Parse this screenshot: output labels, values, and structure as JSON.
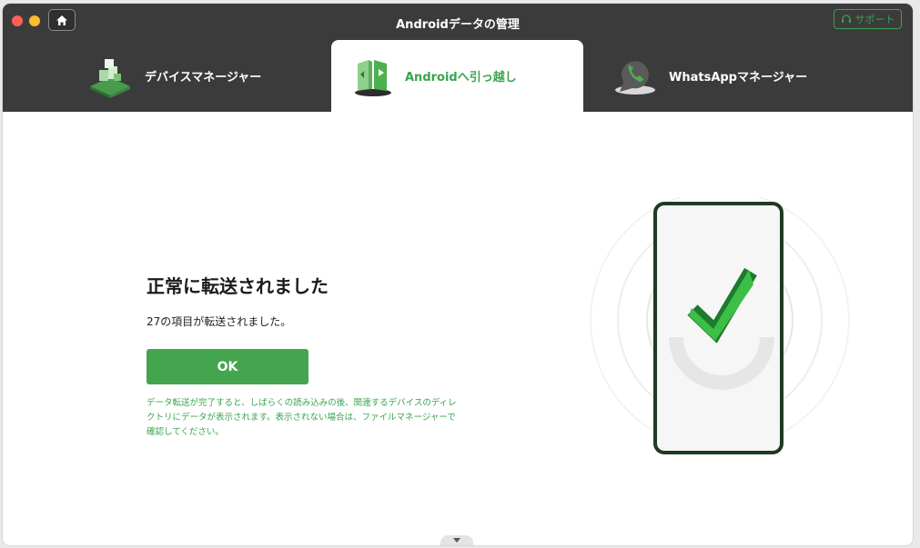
{
  "window": {
    "title": "Androidデータの管理",
    "support_label": "サポート"
  },
  "tabs": [
    {
      "label": "デバイスマネージャー",
      "icon": "device-manager-icon",
      "active": false
    },
    {
      "label": "Androidへ引っ越し",
      "icon": "android-transfer-icon",
      "active": true
    },
    {
      "label": "WhatsAppマネージャー",
      "icon": "whatsapp-manager-icon",
      "active": false
    }
  ],
  "result": {
    "title": "正常に転送されました",
    "subtitle": "27の項目が転送されました。",
    "ok_label": "OK",
    "note_lines": [
      "データ転送が完了すると、しばらくの読み込みの後、関連するデバイスのディレ",
      "クトリにデータが表示されます。表示されない場合は、ファイルマネージャーで",
      "確認してください。"
    ]
  },
  "colors": {
    "accent": "#44a54f",
    "header": "#3b3b3b"
  }
}
